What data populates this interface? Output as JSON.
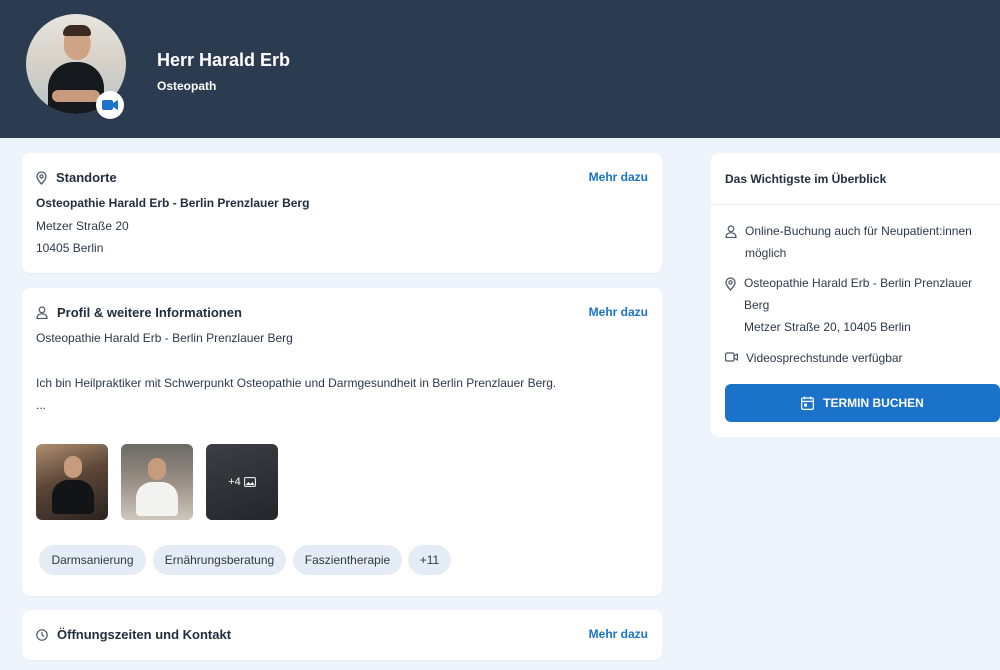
{
  "header": {
    "name": "Herr Harald Erb",
    "role": "Osteopath"
  },
  "locations": {
    "title": "Standorte",
    "more": "Mehr dazu",
    "practice": "Osteopathie Harald Erb - Berlin Prenzlauer Berg",
    "street": "Metzer Straße 20",
    "city": "10405 Berlin"
  },
  "profile": {
    "title": "Profil & weitere Informationen",
    "more": "Mehr dazu",
    "practice": "Osteopathie Harald Erb - Berlin Prenzlauer Berg",
    "bio": "Ich bin Heilpraktiker mit Schwerpunkt Osteopathie und Darmgesundheit in Berlin Prenzlauer Berg.",
    "ellipsis": "...",
    "more_photos": "+4",
    "tags": [
      "Darmsanierung",
      "Ernährungsberatung",
      "Faszientherapie",
      "+11"
    ]
  },
  "hours": {
    "title": "Öffnungszeiten und Kontakt",
    "more": "Mehr dazu"
  },
  "overview": {
    "title": "Das Wichtigste im Überblick",
    "booking_line1": "Online-Buchung auch für Neupatient:innen",
    "booking_line2": "möglich",
    "location_line1": "Osteopathie Harald Erb - Berlin Prenzlauer",
    "location_line2": "Berg",
    "location_line3": "Metzer Straße 20, 10405 Berlin",
    "video": "Videosprechstunde verfügbar",
    "button": "TERMIN BUCHEN"
  },
  "colors": {
    "header_bg": "#2b3c51",
    "accent": "#1a73c8",
    "page_bg": "#eef4fb"
  }
}
